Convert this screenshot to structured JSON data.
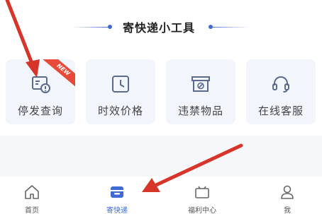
{
  "section": {
    "title": "寄快递小工具"
  },
  "tools": [
    {
      "label": "停发查询",
      "icon": "stop-query-icon",
      "badge": "NEW"
    },
    {
      "label": "时效价格",
      "icon": "clock-icon"
    },
    {
      "label": "违禁物品",
      "icon": "prohibited-box-icon"
    },
    {
      "label": "在线客服",
      "icon": "headset-icon"
    }
  ],
  "tabbar": {
    "active_index": 1,
    "items": [
      {
        "label": "首页",
        "icon": "home-icon"
      },
      {
        "label": "寄快递",
        "icon": "send-package-icon"
      },
      {
        "label": "福利中心",
        "icon": "gift-box-icon"
      },
      {
        "label": "我",
        "icon": "user-icon"
      }
    ]
  },
  "colors": {
    "accent": "#3f69d6",
    "card_bg": "#f2f5fb",
    "badge": "#e84a3a",
    "annotation_arrow": "#d8352a",
    "icon_gray": "#5a6b8c"
  }
}
